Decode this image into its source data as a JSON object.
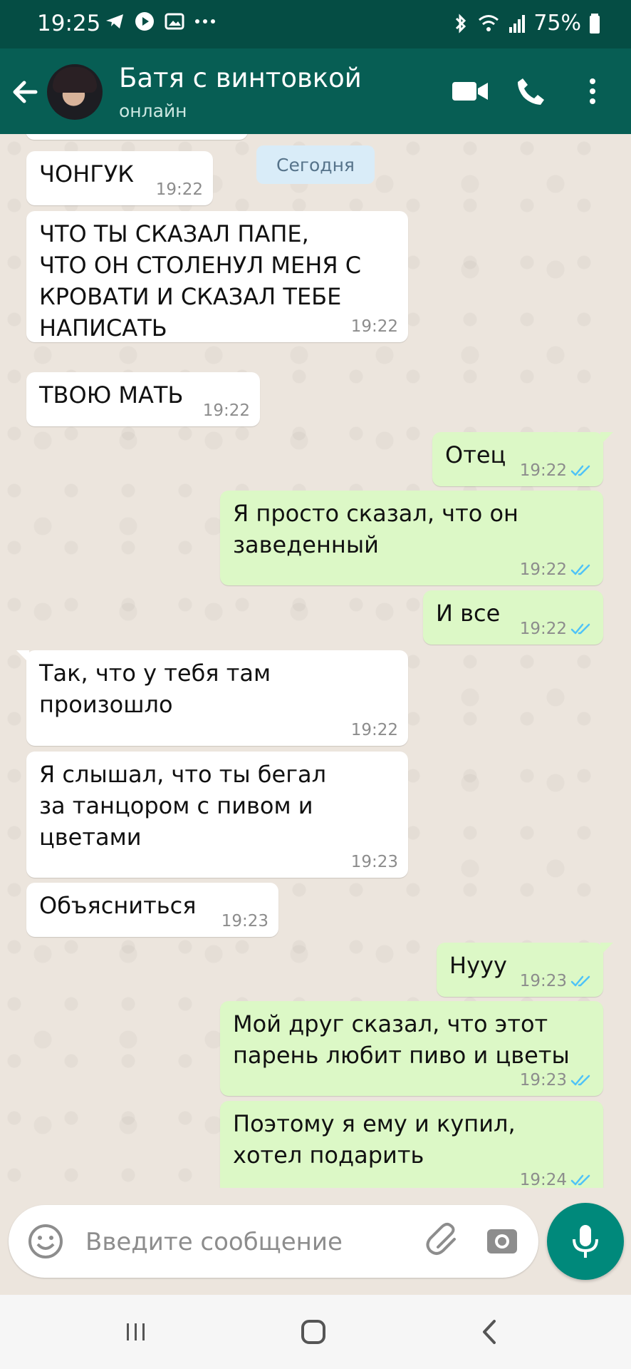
{
  "status_bar": {
    "time": "19:25",
    "battery": "75%",
    "left_icons": [
      "telegram-icon",
      "play-icon",
      "image-icon",
      "more-icon"
    ],
    "right_icons": [
      "bluetooth-icon",
      "wifi-icon",
      "signal-icon",
      "battery-icon"
    ]
  },
  "header": {
    "contact_name": "Батя с винтовкой",
    "status": "онлайн",
    "actions": [
      "video-call-icon",
      "phone-call-icon",
      "more-vert-icon"
    ]
  },
  "date_divider": "Сегодня",
  "messages": [
    {
      "side": "in",
      "text": "ЧОНГУК",
      "time": "19:22"
    },
    {
      "side": "in",
      "text": "ЧТО ТЫ СКАЗАЛ ПАПЕ,\nЧТО ОН СТОЛЕНУЛ МЕНЯ С\nКРОВАТИ И СКАЗАЛ ТЕБЕ\nНАПИСАТЬ",
      "time": "19:22"
    },
    {
      "side": "in",
      "text": "ТВОЮ МАТЬ",
      "time": "19:22"
    },
    {
      "side": "out",
      "text": "Отец",
      "time": "19:22",
      "status": "read"
    },
    {
      "side": "out",
      "text": "Я просто сказал, что он\nзаведенный",
      "time": "19:22",
      "status": "read"
    },
    {
      "side": "out",
      "text": "И все",
      "time": "19:22",
      "status": "read"
    },
    {
      "side": "in",
      "text": "Так, что у тебя там\nпроизошло",
      "time": "19:22"
    },
    {
      "side": "in",
      "text": "Я слышал, что ты бегал\nза танцором с пивом и\nцветами",
      "time": "19:23"
    },
    {
      "side": "in",
      "text": "Объясниться",
      "time": "19:23"
    },
    {
      "side": "out",
      "text": "Нууу",
      "time": "19:23",
      "status": "read"
    },
    {
      "side": "out",
      "text": "Мой друг сказал, что этот\nпарень любит пиво и цветы",
      "time": "19:23",
      "status": "read"
    },
    {
      "side": "out",
      "text": "Поэтому я ему и купил,\nхотел подарить",
      "time": "19:24",
      "status": "read"
    }
  ],
  "composer": {
    "placeholder": "Введите сообщение",
    "value": ""
  },
  "colors": {
    "header": "#075e54",
    "status_bar": "#054d44",
    "chat_background": "#ece5dd",
    "incoming_bubble": "#ffffff",
    "outgoing_bubble": "#dcf8c6",
    "read_ticks": "#4fc3f7",
    "mic_button": "#00897b"
  },
  "nav_icons": [
    "recent-apps-icon",
    "home-icon",
    "back-icon"
  ]
}
